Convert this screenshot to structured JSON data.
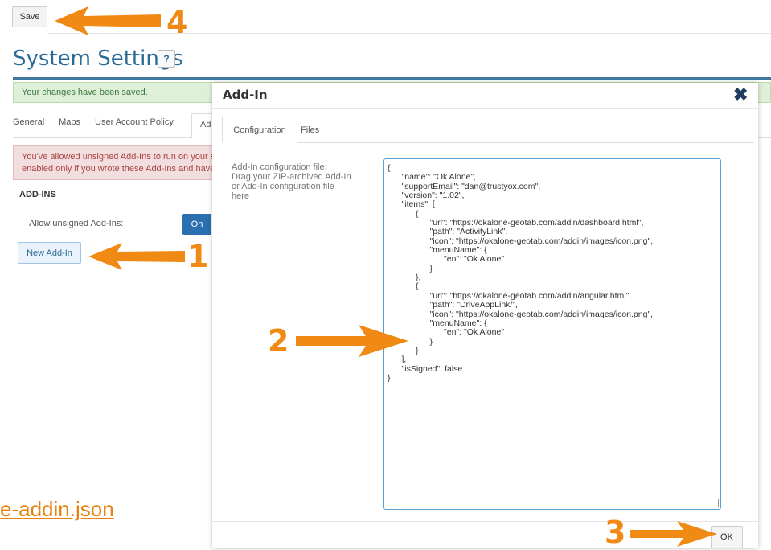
{
  "toolbar": {
    "save_label": "Save"
  },
  "page": {
    "title": "System Settings",
    "help_label": "?"
  },
  "banner": {
    "success": "Your changes have been saved."
  },
  "tabs": [
    "General",
    "Maps",
    "User Account Policy",
    "Ad"
  ],
  "warning": {
    "line1": "You've allowed unsigned Add-Ins to run on your s",
    "line2": "enabled only if you wrote these Add-Ins and have"
  },
  "addins": {
    "heading": "ADD-INS",
    "unsigned_label": "Allow unsigned Add-Ins:",
    "toggle_on": "On",
    "new_button": "New Add-In"
  },
  "file_link": "e-addin.json",
  "modal": {
    "title": "Add-In",
    "close_icon": "close-icon",
    "tabs": [
      "Configuration",
      "Files"
    ],
    "config_label": "Add-In configuration file:\nDrag your ZIP-archived Add-In\nor Add-In configuration file\nhere",
    "code": "{\n      \"name\": \"Ok Alone\",\n      \"supportEmail\": \"dan@trustyox.com\",\n      \"version\": \"1.02\",\n      \"items\": [\n            {\n                  \"url\": \"https://okalone-geotab.com/addin/dashboard.html\",\n                  \"path\": \"ActivityLink\",\n                  \"icon\": \"https://okalone-geotab.com/addin/images/icon.png\",\n                  \"menuName\": {\n                        \"en\": \"Ok Alone\"\n                  }\n            },\n            {\n                  \"url\": \"https://okalone-geotab.com/addin/angular.html\",\n                  \"path\": \"DriveAppLink/\",\n                  \"icon\": \"https://okalone-geotab.com/addin/images/icon.png\",\n                  \"menuName\": {\n                        \"en\": \"Ok Alone\"\n                  }\n            }\n      ],\n      \"isSigned\": false\n}",
    "ok_label": "OK"
  },
  "annotations": {
    "n1": "1",
    "n2": "2",
    "n3": "3",
    "n4": "4",
    "color": "#f08a14"
  }
}
